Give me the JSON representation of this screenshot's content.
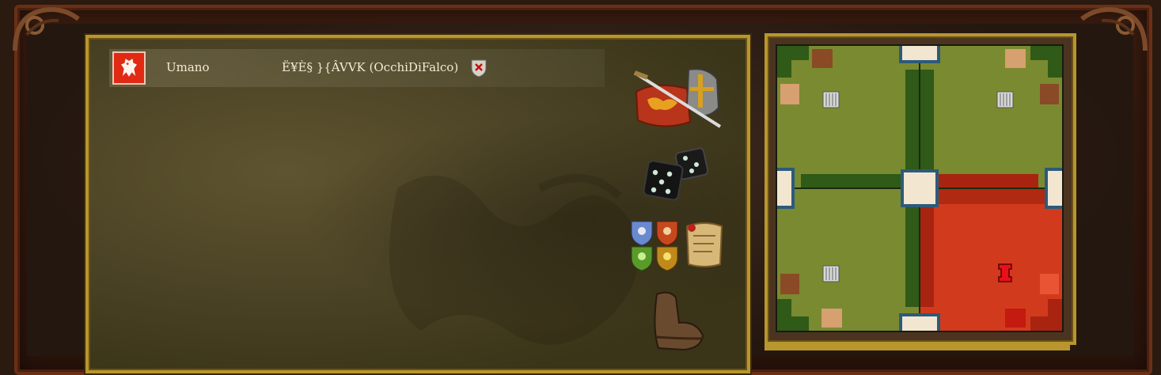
{
  "lobby": {
    "player_slot": {
      "race": "Umano",
      "name": "Ë¥È§ }{ÂVVK (OcchiDiFalco)"
    }
  },
  "colors": {
    "frame_gold": "#b8962e",
    "player_red": "#e02a14",
    "map_grass": "#7a8a30",
    "map_dark_grass": "#2f5a18",
    "map_player_territory": "#d23a1e",
    "slot_marker": "#f2e6d0",
    "slot_border": "#2d5a7a"
  },
  "icons": {
    "team_shields": [
      "blue-lion-shield",
      "red-lion-shield",
      "green-dragon-shield",
      "gold-dragon-shield"
    ]
  },
  "minimap": {
    "quadrants": 4,
    "player_start": "bottom-right"
  }
}
